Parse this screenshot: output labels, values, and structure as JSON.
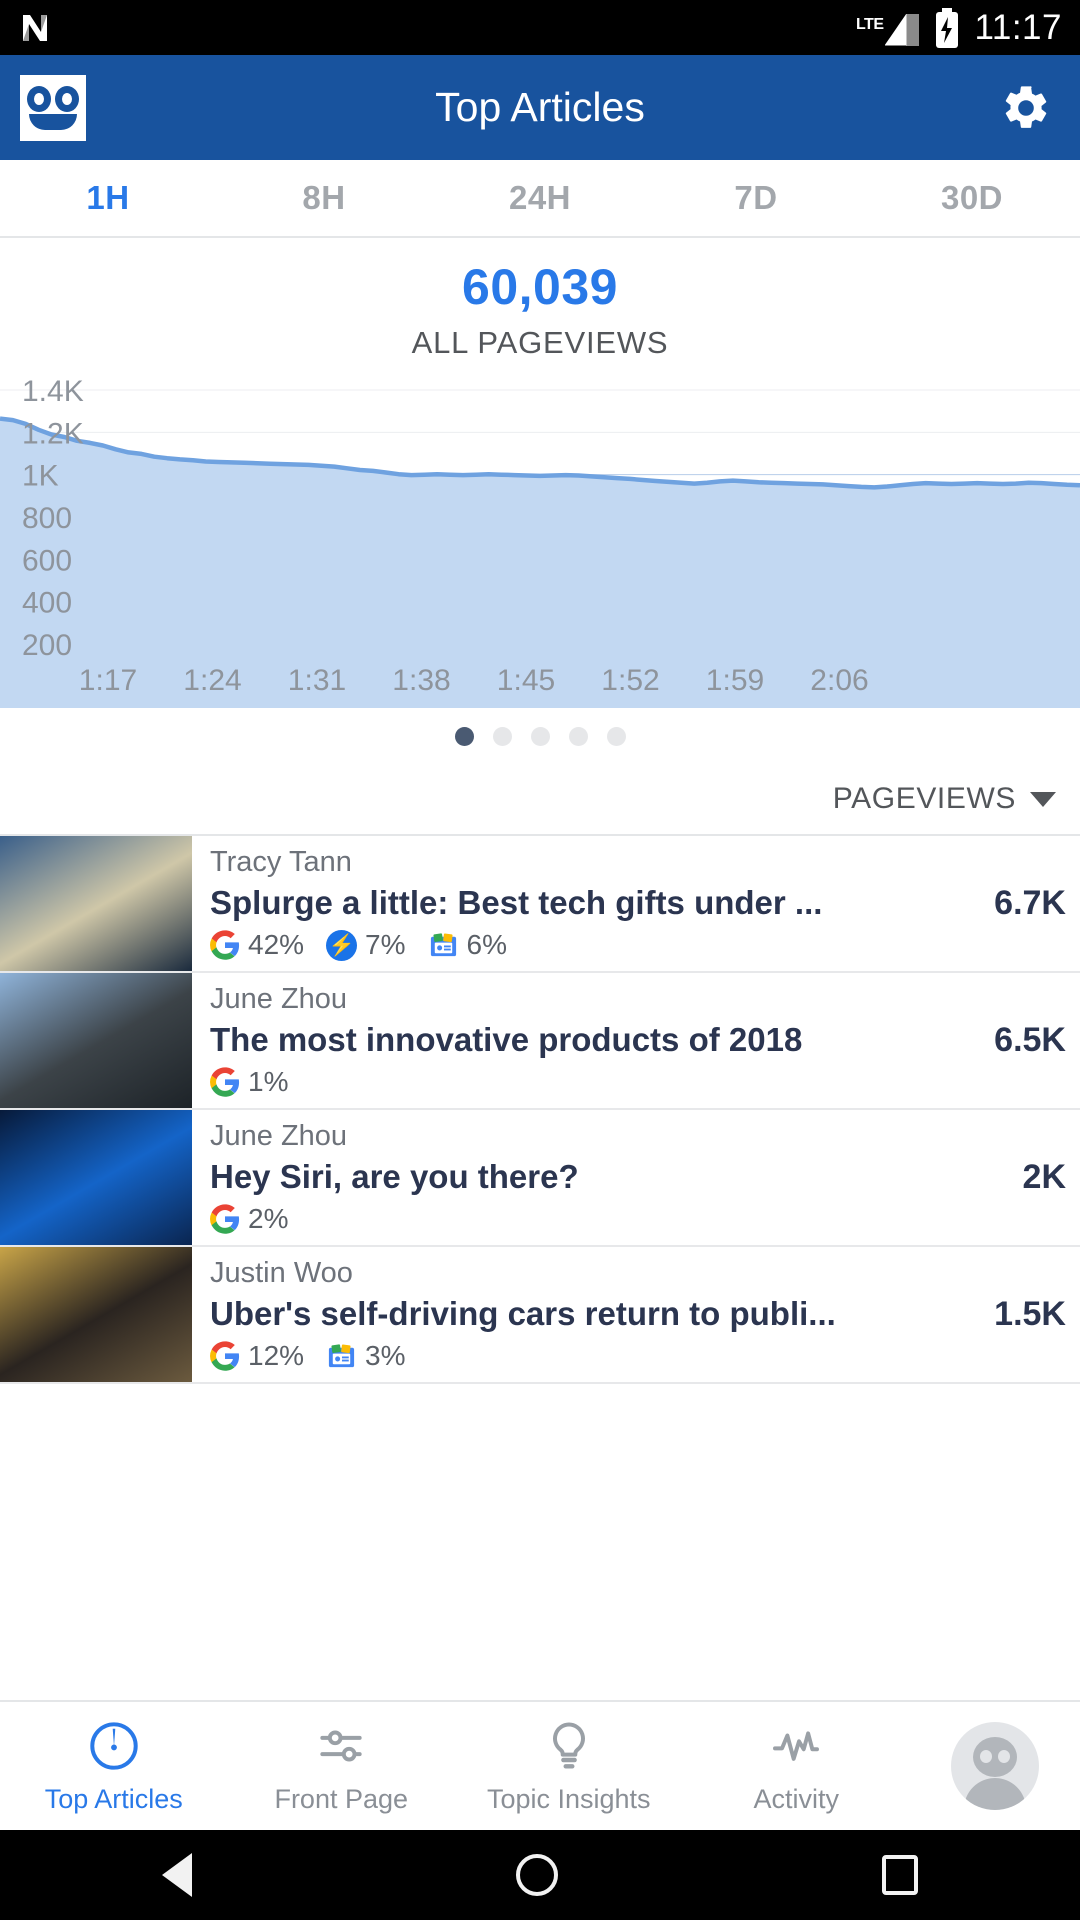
{
  "status_bar": {
    "network_label": "LTE",
    "time": "11:17",
    "notification_icon": "app-notification-icon",
    "battery_icon": "battery-charging-icon",
    "signal_icon": "cell-signal-icon"
  },
  "app_bar": {
    "title": "Top Articles",
    "logo_icon": "chartbeat-robot-logo",
    "settings_icon": "gear-icon"
  },
  "range_tabs": {
    "active_index": 0,
    "items": [
      {
        "label": "1H"
      },
      {
        "label": "8H"
      },
      {
        "label": "24H"
      },
      {
        "label": "7D"
      },
      {
        "label": "30D"
      }
    ]
  },
  "summary": {
    "value": "60,039",
    "label": "ALL PAGEVIEWS",
    "accent_color": "#2979e8"
  },
  "chart_data": {
    "type": "area",
    "title": "",
    "xlabel": "",
    "ylabel": "",
    "ylim": [
      0,
      1500
    ],
    "yticks": [
      "200",
      "400",
      "600",
      "800",
      "1K",
      "1.2K",
      "1.4K"
    ],
    "ytick_values": [
      200,
      400,
      600,
      800,
      1000,
      1200,
      1400
    ],
    "xticks": [
      "1:17",
      "1:24",
      "1:31",
      "1:38",
      "1:45",
      "1:52",
      "1:59",
      "2:06"
    ],
    "grid": true,
    "legend": "none",
    "line_color": "#6fa2e0",
    "fill_color": "#c2d8f2",
    "series": [
      {
        "name": "Pageviews",
        "values": [
          1265,
          1258,
          1240,
          1212,
          1190,
          1178,
          1160,
          1150,
          1138,
          1120,
          1105,
          1098,
          1085,
          1078,
          1072,
          1068,
          1062,
          1060,
          1058,
          1056,
          1054,
          1052,
          1050,
          1048,
          1046,
          1042,
          1038,
          1030,
          1022,
          1018,
          1010,
          1002,
          998,
          1000,
          1002,
          1000,
          998,
          1000,
          1002,
          1000,
          998,
          996,
          994,
          996,
          998,
          996,
          992,
          988,
          984,
          980,
          975,
          970,
          966,
          962,
          958,
          962,
          968,
          972,
          968,
          964,
          962,
          960,
          958,
          956,
          954,
          950,
          946,
          942,
          940,
          944,
          950,
          956,
          960,
          958,
          956,
          958,
          960,
          958,
          956,
          958,
          962,
          960,
          956,
          952,
          950
        ]
      }
    ]
  },
  "pager": {
    "total": 5,
    "active_index": 0
  },
  "sort": {
    "label": "PAGEVIEWS",
    "caret_icon": "chevron-down-icon"
  },
  "articles": [
    {
      "author": "Tracy Tann",
      "headline": "Splurge a little: Best tech gifts under ...",
      "count": "6.7K",
      "thumbnail": "man-at-computer-photo",
      "sources": [
        {
          "icon": "google-icon",
          "value": "42%"
        },
        {
          "icon": "amp-icon",
          "value": "7%"
        },
        {
          "icon": "google-news-icon",
          "value": "6%"
        }
      ]
    },
    {
      "author": "June Zhou",
      "headline": "The most innovative products of 2018",
      "count": "6.5K",
      "thumbnail": "police-press-conference-photo",
      "sources": [
        {
          "icon": "google-icon",
          "value": "1%"
        }
      ]
    },
    {
      "author": "June Zhou",
      "headline": "Hey Siri, are you there?",
      "count": "2K",
      "thumbnail": "news-globe-graphic-photo",
      "sources": [
        {
          "icon": "google-icon",
          "value": "2%"
        }
      ]
    },
    {
      "author": "Justin Woo",
      "headline": "Uber's self-driving cars return to publi...",
      "count": "1.5K",
      "thumbnail": "press-room-crowd-photo",
      "sources": [
        {
          "icon": "google-icon",
          "value": "12%"
        },
        {
          "icon": "google-news-icon",
          "value": "3%"
        }
      ]
    }
  ],
  "bottom_nav": {
    "active_index": 0,
    "items": [
      {
        "label": "Top Articles",
        "icon": "gauge-icon"
      },
      {
        "label": "Front Page",
        "icon": "sliders-icon"
      },
      {
        "label": "Topic Insights",
        "icon": "lightbulb-icon"
      },
      {
        "label": "Activity",
        "icon": "pulse-icon"
      }
    ],
    "avatar_icon": "user-avatar-icon"
  },
  "android_nav": {
    "back_icon": "back-triangle-icon",
    "home_icon": "home-circle-icon",
    "recents_icon": "recents-square-icon"
  }
}
